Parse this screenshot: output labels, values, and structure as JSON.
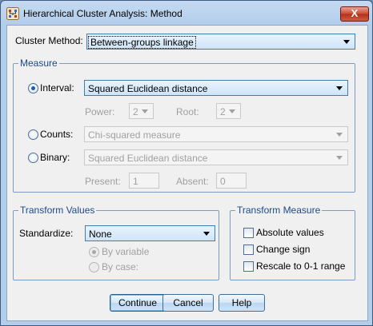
{
  "window": {
    "title": "Hierarchical Cluster Analysis: Method",
    "close_label": "X"
  },
  "cluster_method": {
    "label": "Cluster Method:",
    "value": "Between-groups linkage"
  },
  "measure": {
    "legend": "Measure",
    "interval": {
      "label": "Interval:",
      "value": "Squared Euclidean distance",
      "selected": true
    },
    "power": {
      "label": "Power:",
      "value": "2"
    },
    "root": {
      "label": "Root:",
      "value": "2"
    },
    "counts": {
      "label": "Counts:",
      "value": "Chi-squared measure",
      "selected": false
    },
    "binary": {
      "label": "Binary:",
      "value": "Squared Euclidean distance",
      "selected": false
    },
    "present": {
      "label": "Present:",
      "value": "1"
    },
    "absent": {
      "label": "Absent:",
      "value": "0"
    }
  },
  "transform_values": {
    "legend": "Transform Values",
    "standardize_label": "Standardize:",
    "standardize_value": "None",
    "by_variable": "By variable",
    "by_case": "By case:"
  },
  "transform_measure": {
    "legend": "Transform Measure",
    "absolute_values": "Absolute values",
    "change_sign": "Change sign",
    "rescale": "Rescale to 0-1 range"
  },
  "buttons": {
    "continue": "Continue",
    "cancel": "Cancel",
    "help": "Help"
  },
  "colors": {
    "accent": "#1a5fb4",
    "group_border": "#7a9cc6",
    "close": "#c84a33"
  },
  "icons": {
    "app": "cluster-analysis-icon",
    "close": "close-icon",
    "dropdown": "chevron-down-icon"
  }
}
